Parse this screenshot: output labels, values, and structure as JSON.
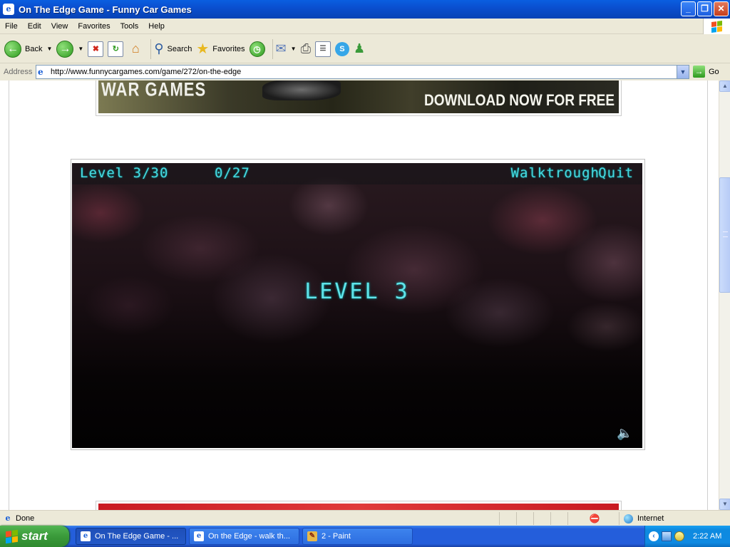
{
  "window": {
    "title": "On The Edge Game - Funny Car Games",
    "controls": {
      "minimize": "_",
      "maximize": "❐",
      "close": "✕"
    }
  },
  "menu": [
    "File",
    "Edit",
    "View",
    "Favorites",
    "Tools",
    "Help"
  ],
  "toolbar": {
    "back_label": "Back",
    "search_label": "Search",
    "favorites_label": "Favorites"
  },
  "address": {
    "label": "Address",
    "url": "http://www.funnycargames.com/game/272/on-the-edge",
    "go_label": "Go"
  },
  "page": {
    "banner_top": {
      "headline": "WAR GAMES",
      "cta": "DOWNLOAD NOW FOR FREE"
    },
    "game": {
      "level_indicator": "Level 3/30",
      "score": "0/27",
      "walkthrough_label": "Walktrough",
      "quit_label": "Quit",
      "center_text": "LEVEL 3",
      "sound_icon": "speaker-icon"
    }
  },
  "status": {
    "text": "Done",
    "zone": "Internet"
  },
  "taskbar": {
    "start_label": "start",
    "tasks": [
      {
        "label": "On The Edge Game - ...",
        "active": true
      },
      {
        "label": "On the Edge - walk th...",
        "active": false
      },
      {
        "label": "2 - Paint",
        "active": false
      }
    ],
    "clock": "2:22 AM"
  },
  "colors": {
    "hud_text": "#48d8e0",
    "titlebar": "#0a4fd0",
    "taskbar": "#245edb"
  }
}
